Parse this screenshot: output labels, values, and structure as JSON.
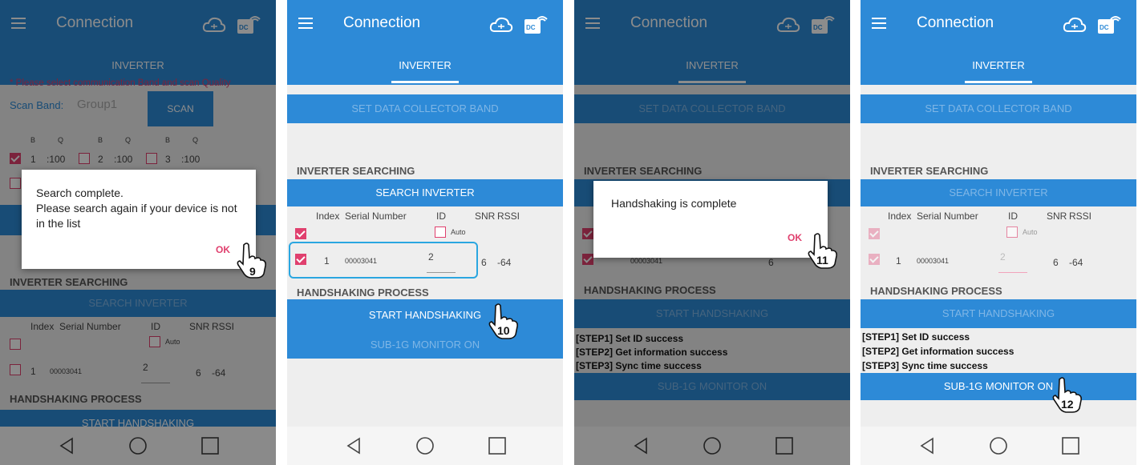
{
  "app": {
    "title": "Connection",
    "tab": "INVERTER",
    "accent": "#2d8ad7",
    "check_color": "#e0406e"
  },
  "icons": {
    "menu": "hamburger-icon",
    "cloud": "cloud-icon",
    "dc": "dc-wifi-icon",
    "nav": [
      "back-icon",
      "home-icon",
      "recents-icon"
    ]
  },
  "screen1": {
    "notice": "* Please select communication Band and scan Quality",
    "scan_band_label": "Scan Band:",
    "scan_band_value": "Group1",
    "scan_button": "SCAN",
    "bq_headers": [
      "B",
      "Q",
      "B",
      "Q",
      "B",
      "Q"
    ],
    "bands": [
      {
        "b": "1",
        "q": ":100"
      },
      {
        "b": "2",
        "q": ":100"
      },
      {
        "b": "3",
        "q": ":100"
      }
    ],
    "dialog": {
      "line1": "Search complete.",
      "line2": "Please search again if your device is not in the list",
      "ok": "OK"
    },
    "step": "9"
  },
  "common": {
    "set_dc_band": "SET DATA COLLECTOR BAND",
    "inverter_searching": "INVERTER SEARCHING",
    "search_inverter": "SEARCH INVERTER",
    "col_index": "Index",
    "col_serial": "Serial Number",
    "col_id": "ID",
    "col_snr": "SNR",
    "col_rssi": "RSSI",
    "auto": "Auto",
    "row": {
      "index": "1",
      "serial": "00003041",
      "id": "2",
      "snr": "6",
      "rssi": "-64"
    },
    "handshaking_process": "HANDSHAKING PROCESS",
    "start_handshaking": "START HANDSHAKING",
    "sub1g": "SUB-1G MONITOR ON",
    "step1": "[STEP1] Set ID success",
    "step2": "[STEP2] Get information success",
    "step3": "[STEP3] Sync time success"
  },
  "screen2": {
    "step": "10"
  },
  "screen3": {
    "dialog": {
      "text": "Handshaking is complete",
      "ok": "OK"
    },
    "step": "11"
  },
  "screen4": {
    "step": "12"
  }
}
